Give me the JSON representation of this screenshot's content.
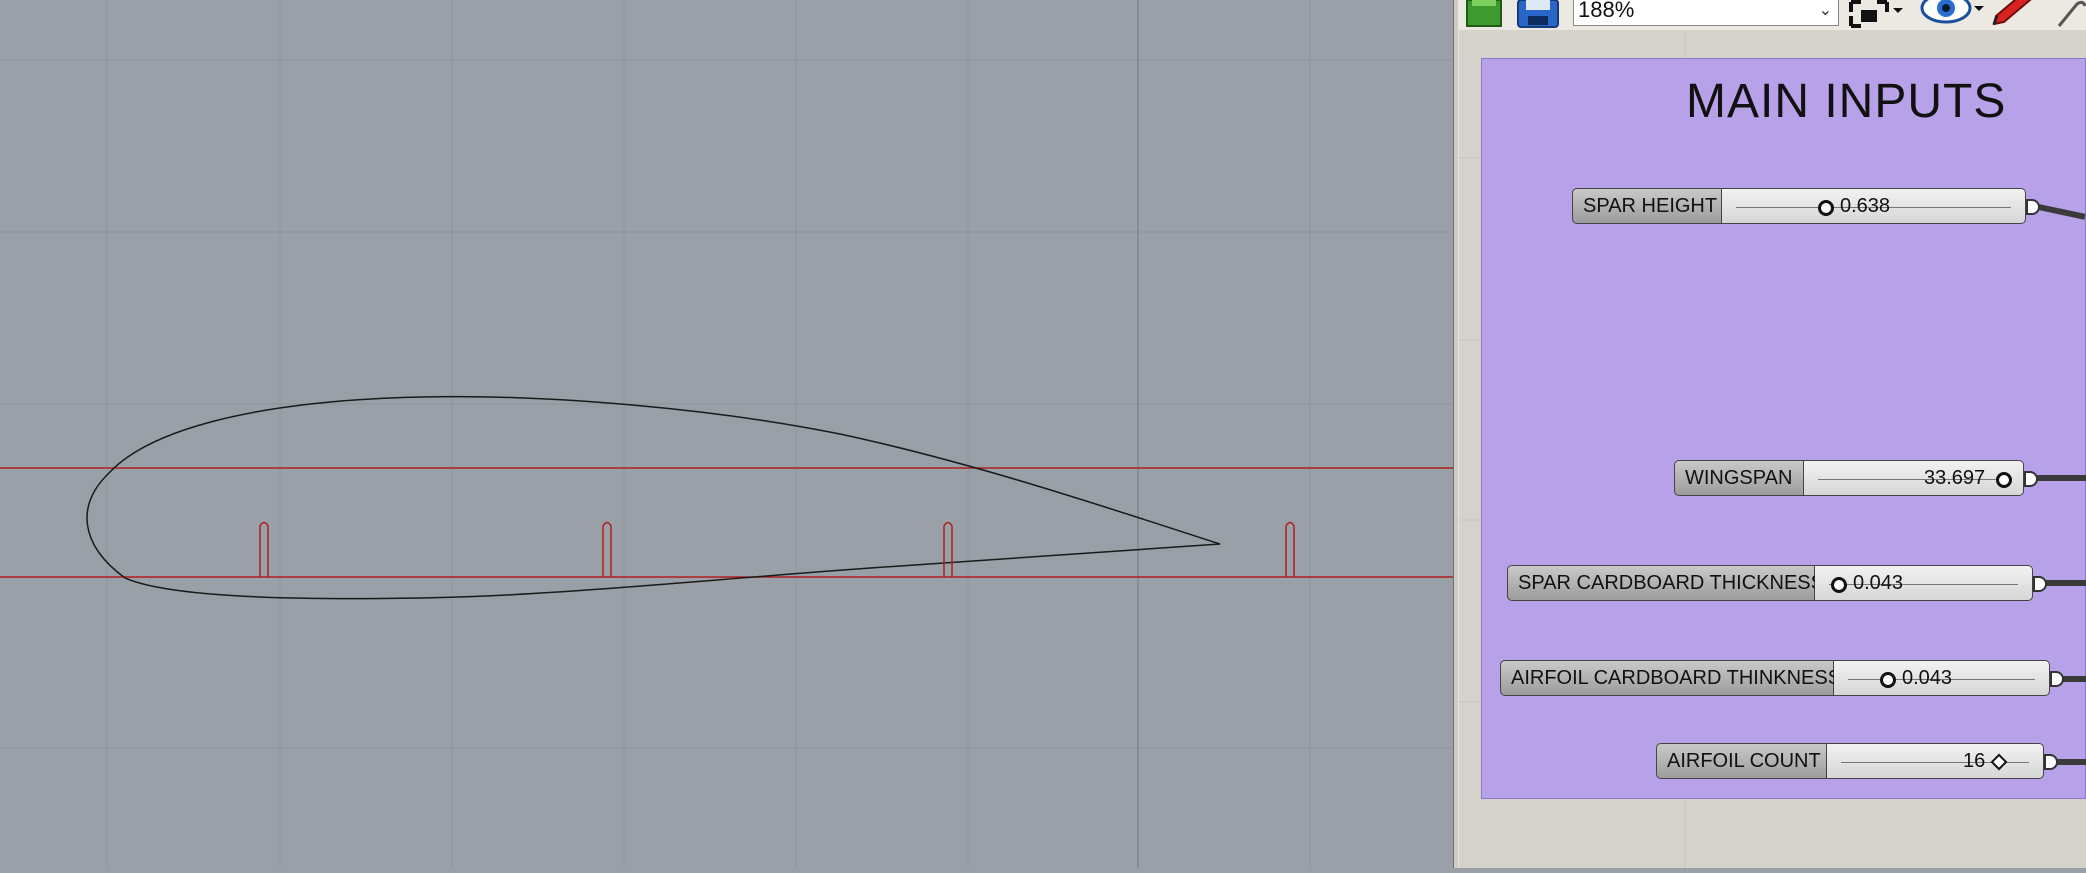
{
  "toolbar": {
    "zoom_value": "188%",
    "icons": [
      "new-document-icon",
      "save-icon",
      "zoom-extents-icon",
      "preview-eye-icon",
      "sketch-pen-icon",
      "clip-icon"
    ]
  },
  "group": {
    "title": "MAIN INPUTS",
    "color": "#b7a1e8"
  },
  "sliders": [
    {
      "label": "SPAR HEIGHT",
      "value": "0.638"
    },
    {
      "label": "WINGSPAN",
      "value": "33.697"
    },
    {
      "label": "SPAR CARDBOARD THICKNESS",
      "value": "0.043"
    },
    {
      "label": "AIRFOIL CARDBOARD THINKNESS",
      "value": "0.043"
    },
    {
      "label": "AIRFOIL COUNT",
      "value": "16"
    }
  ],
  "colors": {
    "viewport_bg": "#9aa0a8",
    "guide_lines": "#b01e1e",
    "airfoil_curve": "#1a1a1a"
  }
}
